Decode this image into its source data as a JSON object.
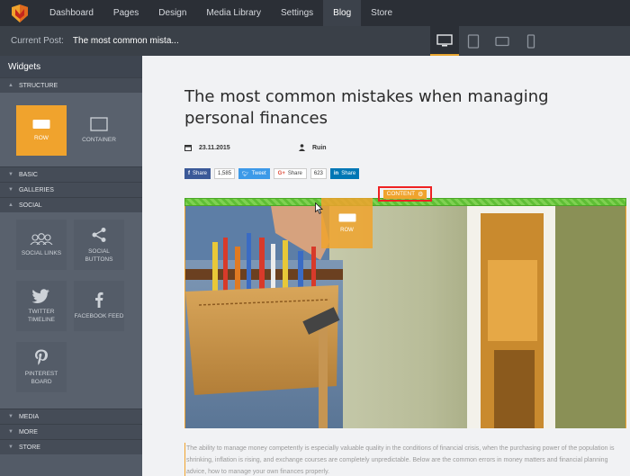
{
  "nav": {
    "items": [
      {
        "label": "Dashboard"
      },
      {
        "label": "Pages"
      },
      {
        "label": "Design"
      },
      {
        "label": "Media Library"
      },
      {
        "label": "Settings"
      },
      {
        "label": "Blog",
        "active": true
      },
      {
        "label": "Store"
      }
    ],
    "logo_icon": "logo-icon"
  },
  "postbar": {
    "label": "Current Post:",
    "value": "The most common mista...",
    "devices": [
      "desktop-icon",
      "tablet-icon",
      "tablet-landscape-icon",
      "phone-icon"
    ],
    "active_device": "desktop-icon"
  },
  "sidebar": {
    "title": "Widgets",
    "sections": {
      "structure": "STRUCTURE",
      "basic": "BASIC",
      "galleries": "GALLERIES",
      "social": "SOCIAL",
      "media": "MEDIA",
      "more": "MORE",
      "store": "STORE"
    },
    "structure_tiles": [
      {
        "label": "ROW",
        "icon": "row-icon"
      },
      {
        "label": "CONTAINER",
        "icon": "container-icon"
      }
    ],
    "social_tiles": [
      {
        "label": "SOCIAL LINKS",
        "icon": "social-links-icon"
      },
      {
        "label": "SOCIAL BUTTONS",
        "icon": "share-icon"
      },
      {
        "label": "TWITTER TIMELINE",
        "icon": "twitter-icon"
      },
      {
        "label": "FACEBOOK FEED",
        "icon": "facebook-icon"
      },
      {
        "label": "PINTEREST BOARD",
        "icon": "pinterest-icon"
      }
    ]
  },
  "post": {
    "title": "The most common mistakes when managing personal finances",
    "date": "23.11.2015",
    "author": "Ruin",
    "share": {
      "facebook_label": "Share",
      "facebook_count": "1,585",
      "tweet_label": "Tweet",
      "gplus_label": "Share",
      "gplus_count": "623",
      "linkedin_label": "Share"
    },
    "content_badge": "CONTENT",
    "drag_label": "ROW",
    "body": "The ability to manage money competently is especially valuable quality in the conditions of financial crisis, when the purchasing power of the population is shrinking, inflation is rising, and exchange courses are completely unpredictable. Below are the common errors in money matters and financial planning advice, how to manage your own finances properly."
  },
  "colors": {
    "accent": "#f0a32d",
    "nav_bg": "#2b2f36",
    "sidebar_bg": "#535b67",
    "row_green": "#5fbe35",
    "highlight_red": "#e22222"
  }
}
